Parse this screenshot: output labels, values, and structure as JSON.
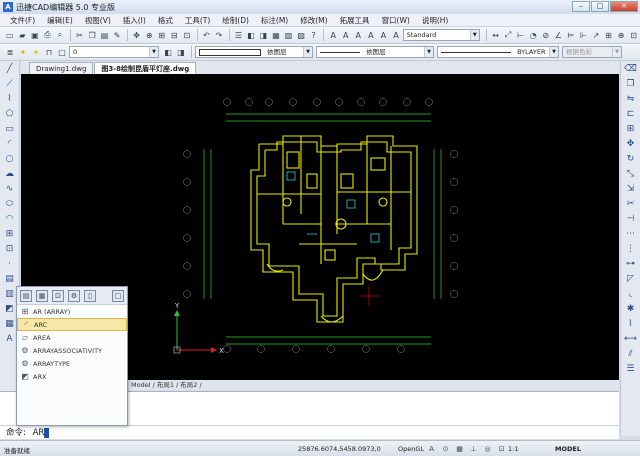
{
  "app": {
    "title": "迅捷CAD编辑器 5.0 专业版",
    "icon_letter": "A",
    "window_buttons": [
      "minimize",
      "maximize",
      "close"
    ]
  },
  "menu": [
    "文件(F)",
    "编辑(E)",
    "视图(V)",
    "插入(I)",
    "格式",
    "工具(T)",
    "绘制(D)",
    "标注(M)",
    "修改(M)",
    "拓展工具",
    "窗口(W)",
    "说明(H)"
  ],
  "toolbar1": {
    "text_style": "Standard"
  },
  "toolbar2": {
    "layer": "0",
    "color": "依图层",
    "linetype": "依图层",
    "lineweight": "BYLAYER",
    "plotstyle": "根据色彩"
  },
  "doc_tabs": [
    {
      "label": "Drawing1.dwg",
      "active": false
    },
    {
      "label": "图3-8绘制昆盾平灯座.dwg",
      "active": true
    }
  ],
  "layout_tabs": "Model / 布局1 / 布局2 /",
  "autocomplete": {
    "items": [
      {
        "label": "AR (ARRAY)",
        "icon": "array-icon",
        "selected": false
      },
      {
        "label": "ARC",
        "icon": "arc-icon",
        "selected": true
      },
      {
        "label": "AREA",
        "icon": "area-icon",
        "selected": false
      },
      {
        "label": "ARRAYASSOCIATIVITY",
        "icon": "gear-icon",
        "selected": false
      },
      {
        "label": "ARRAYTYPE",
        "icon": "gear-icon",
        "selected": false
      },
      {
        "label": "ARX",
        "icon": "app-icon",
        "selected": false
      }
    ]
  },
  "command": {
    "prompt": "命令:",
    "input": "AR"
  },
  "status": {
    "ready": "准备就绪",
    "coords": "25876.6074,5458.0973,0",
    "renderer": "OpenGL",
    "scale": "1:1",
    "space": "MODEL"
  },
  "colors": {
    "canvas_bg": "#000000",
    "plan_lines": "#e8e800",
    "dim_lines": "#2ad02a",
    "ucs_x": "#e02020",
    "ucs_y": "#30c030",
    "cross": "#c00000"
  }
}
